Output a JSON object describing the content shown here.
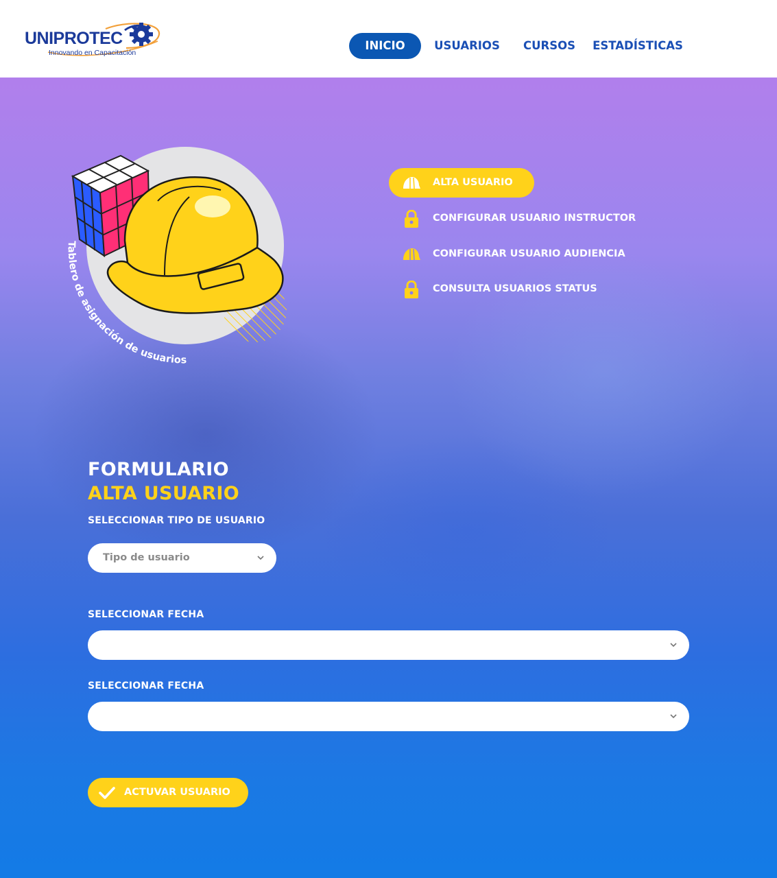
{
  "brand": {
    "name": "UNIPROTEC",
    "tagline": "Innovando en Capacitación"
  },
  "nav": {
    "items": [
      {
        "label": "INICIO",
        "active": true
      },
      {
        "label": "USUARIOS",
        "active": false
      },
      {
        "label": "CURSOS",
        "active": false
      },
      {
        "label": "ESTADÍSTICAS",
        "active": false
      }
    ]
  },
  "illustration": {
    "caption": "Tablero de asignación de usuarios",
    "icons": [
      "rubiks-cube",
      "safety-helmet"
    ]
  },
  "side_menu": {
    "items": [
      {
        "label": "ALTA USUARIO",
        "icon": "helmet-icon",
        "active": true
      },
      {
        "label": "CONFIGURAR USUARIO INSTRUCTOR",
        "icon": "lock-icon",
        "active": false
      },
      {
        "label": "CONFIGURAR USUARIO AUDIENCIA",
        "icon": "helmet-icon",
        "active": false
      },
      {
        "label": "CONSULTA USUARIOS STATUS",
        "icon": "lock-icon",
        "active": false
      }
    ]
  },
  "form": {
    "title_line1": "FORMULARIO",
    "title_line2": "ALTA USUARIO",
    "user_type": {
      "label": "SELECCIONAR TIPO DE USUARIO",
      "placeholder": "Tipo de usuario",
      "value": ""
    },
    "date_1": {
      "label": "SELECCIONAR FECHA",
      "value": ""
    },
    "date_2": {
      "label": "SELECCIONAR FECHA",
      "value": ""
    },
    "submit_label": "ACTUVAR USUARIO"
  },
  "colors": {
    "brand_blue": "#1b3a9a",
    "nav_active": "#0b57b3",
    "accent_yellow": "#ffd21a",
    "gradient_top": "#b17fec",
    "gradient_bottom": "#137be6"
  }
}
